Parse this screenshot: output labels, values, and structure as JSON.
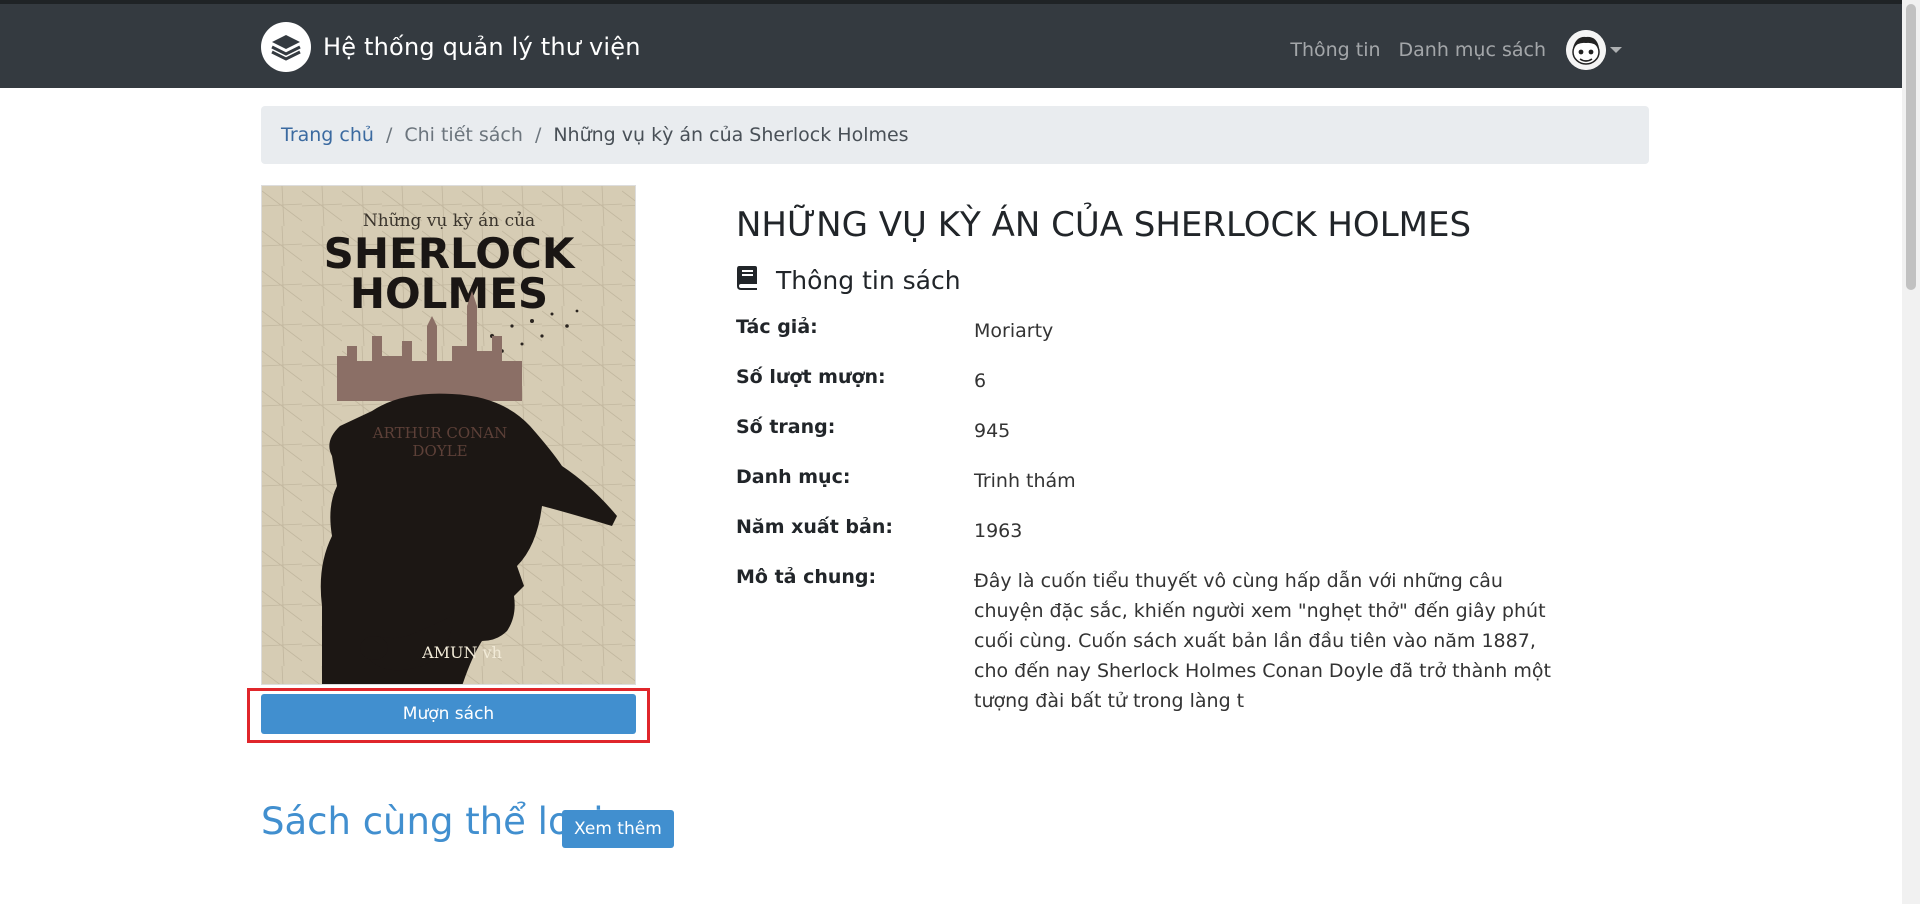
{
  "navbar": {
    "brand_title": "Hệ thống quản lý thư viện",
    "links": [
      "Thông tin",
      "Danh mục sách"
    ]
  },
  "breadcrumb": {
    "home": "Trang chủ",
    "middle": "Chi tiết sách",
    "current": "Những vụ kỳ án của Sherlock Holmes"
  },
  "cover": {
    "top_line": "Những vụ kỳ án của",
    "title_line1": "SHERLOCK",
    "title_line2": "HOLMES",
    "author_line1": "ARTHUR CONAN",
    "author_line2": "DOYLE",
    "publisher": "AMUN vh"
  },
  "borrow_label": "Mượn sách",
  "book": {
    "title": "NHỮNG VỤ KỲ ÁN CỦA SHERLOCK HOLMES",
    "section_label": "Thông tin sách",
    "fields": [
      {
        "label": "Tác giả:",
        "value": "Moriarty"
      },
      {
        "label": "Số lượt mượn:",
        "value": "6"
      },
      {
        "label": "Số trang:",
        "value": "945"
      },
      {
        "label": "Danh mục:",
        "value": "Trinh thám"
      },
      {
        "label": "Năm xuất bản:",
        "value": "1963"
      },
      {
        "label": "Mô tả chung:",
        "value": "Đây là cuốn tiểu thuyết vô cùng hấp dẫn với những câu chuyện đặc sắc, khiến người xem \"nghẹt thở\" đến giây phút cuối cùng. Cuốn sách xuất bản lần đầu tiên vào năm 1887, cho đến nay Sherlock Holmes Conan Doyle đã trở thành một tượng đài bất tử trong làng t"
      }
    ]
  },
  "related": {
    "title": "Sách cùng thể loại",
    "more_label": "Xem thêm"
  },
  "colors": {
    "navbar": "#343a40",
    "accent": "#418fcf",
    "highlight_border": "#e0262b"
  }
}
